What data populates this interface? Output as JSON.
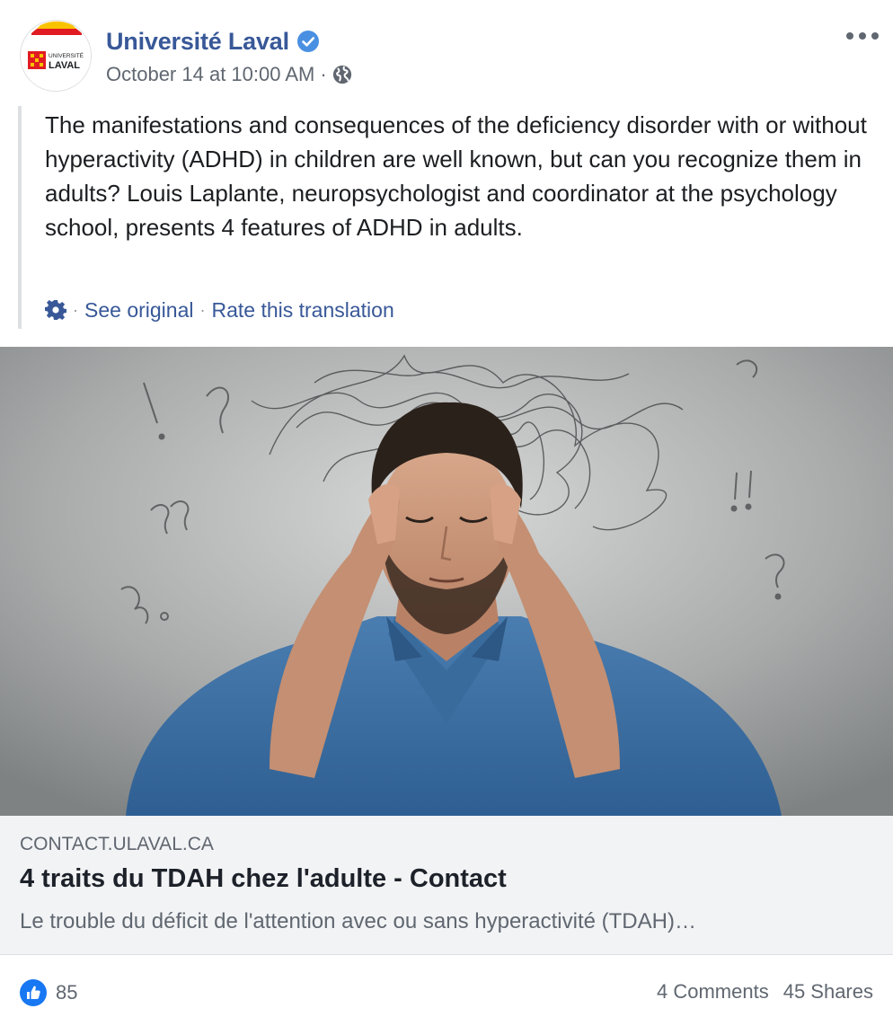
{
  "header": {
    "page_name": "Université Laval",
    "timestamp": "October 14 at 10:00 AM",
    "separator": "·",
    "logo_text_top": "UNIVERSITÉ",
    "logo_text_bottom": "LAVAL",
    "icons": {
      "verified": "verified-badge-icon",
      "audience": "globe-icon",
      "menu": "more-options-icon"
    }
  },
  "post": {
    "text": "The manifestations and consequences of the deficiency disorder with or without hyperactivity (ADHD) in children are well known, but can you recognize them in adults? Louis Laplante, neuropsychologist and coordinator at the psychology school, presents 4 features of ADHD in adults.",
    "translation": {
      "separator": "·",
      "see_original": "See original",
      "rate_translation": "Rate this translation"
    }
  },
  "link_preview": {
    "domain": "CONTACT.ULAVAL.CA",
    "title": "4 traits du TDAH chez l'adulte - Contact",
    "description": "Le trouble du déficit de l'attention avec ou sans hyperactivité (TDAH)…"
  },
  "footer": {
    "like_count": "85",
    "comments": "4 Comments",
    "shares": "45 Shares"
  },
  "colors": {
    "link_blue": "#385898",
    "like_blue": "#1877f2",
    "secondary_text": "#606770",
    "preview_bg": "#f2f3f5",
    "shirt_blue": "#3e6e9f",
    "background_gray": "#9b9d9e"
  }
}
